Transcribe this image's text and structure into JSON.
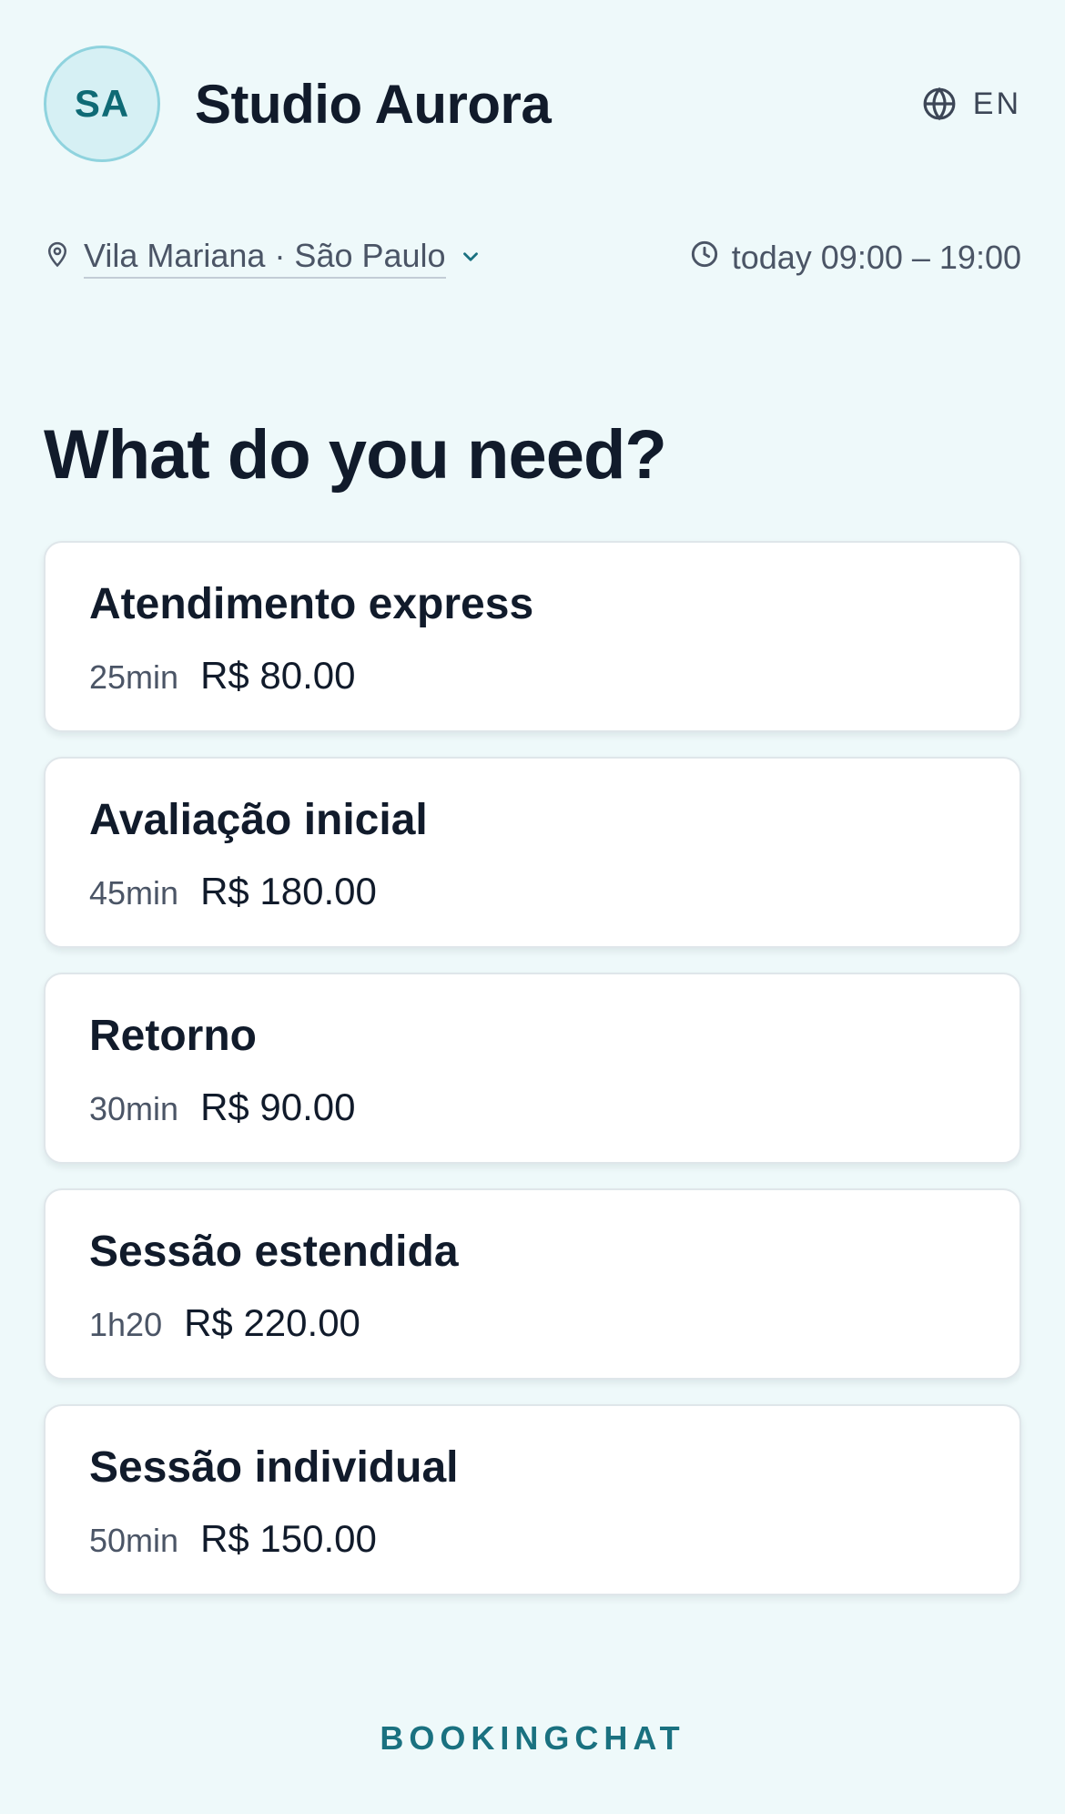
{
  "header": {
    "avatar_initials": "SA",
    "studio_name": "Studio Aurora",
    "language": "EN"
  },
  "meta": {
    "location": "Vila Mariana · São Paulo",
    "hours": "today 09:00 – 19:00"
  },
  "main": {
    "heading": "What do you need?",
    "services": [
      {
        "name": "Atendimento express",
        "duration": "25min",
        "price": "R$ 80.00"
      },
      {
        "name": "Avaliação inicial",
        "duration": "45min",
        "price": "R$ 180.00"
      },
      {
        "name": "Retorno",
        "duration": "30min",
        "price": "R$ 90.00"
      },
      {
        "name": "Sessão estendida",
        "duration": "1h20",
        "price": "R$ 220.00"
      },
      {
        "name": "Sessão individual",
        "duration": "50min",
        "price": "R$ 150.00"
      }
    ]
  },
  "footer": {
    "brand": "BOOKINGCHAT"
  },
  "colors": {
    "background": "#eef9fa",
    "accent": "#1a7180",
    "avatar_bg": "#d6f0f4",
    "avatar_border": "#8fd3de",
    "text_primary": "#111b2b",
    "text_secondary": "#4b5566"
  },
  "icons": {
    "language": "globe-icon",
    "location": "map-pin-icon",
    "location_dropdown": "chevron-down-icon",
    "hours": "clock-icon"
  }
}
